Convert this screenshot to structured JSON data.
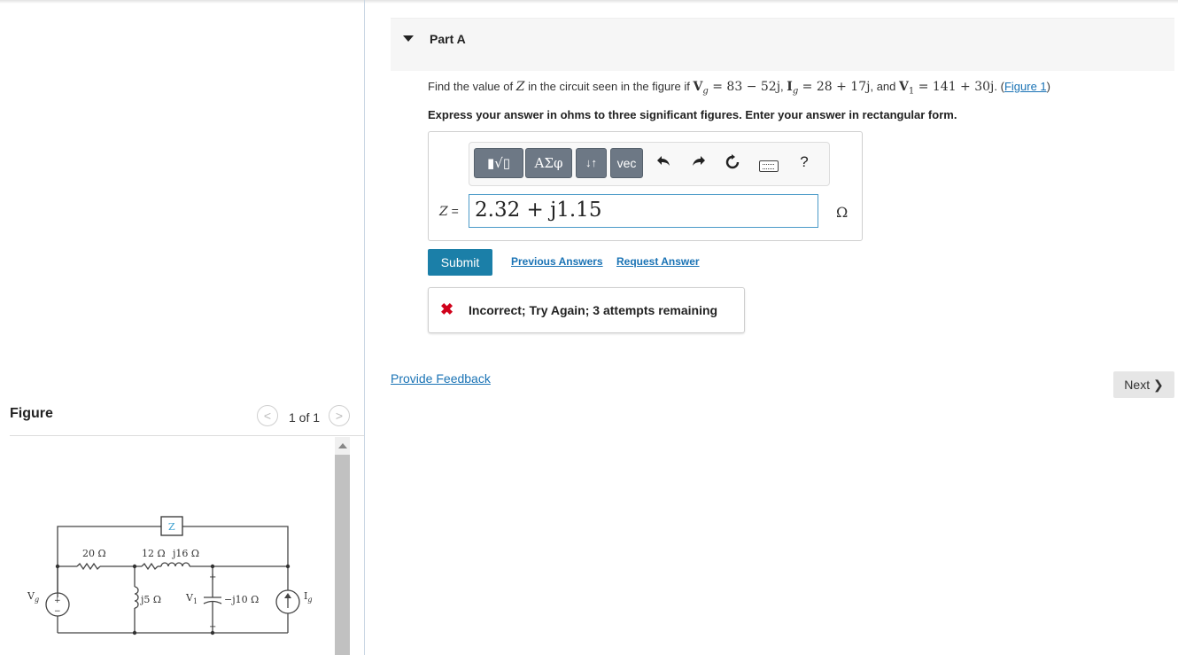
{
  "part": {
    "title": "Part A"
  },
  "question": {
    "find": "Find the value of ",
    "z": "Z",
    "mid": " in the circuit seen in the figure if ",
    "vg": "V",
    "vg_sub": "g",
    "vg_val": " = 83 − 52j",
    "comma1": ", ",
    "ig": "I",
    "ig_sub": "g",
    "ig_val": " = 28 + 17j",
    "and": ", and ",
    "v1": "V",
    "v1_sub": "1",
    "v1_val": " = 141 + 30j",
    "period": ". (",
    "figure_link": "Figure 1",
    "close": ")"
  },
  "instruction": "Express your answer in ohms to three significant figures. Enter your answer in rectangular form.",
  "toolbar": {
    "templates_label": "▮√▯",
    "greek_label": "ΑΣφ",
    "arrows_label": "↓↑",
    "vec_label": "vec",
    "undo_icon": "undo-icon",
    "redo_icon": "redo-icon",
    "reset_icon": "reset-icon",
    "keyboard_icon": "keyboard-icon",
    "help_label": "?"
  },
  "answer": {
    "label_var": "Z",
    "label_eq": " = ",
    "value": "2.32 + j1.15",
    "unit": "Ω"
  },
  "actions": {
    "submit": "Submit",
    "previous_answers": "Previous Answers",
    "request_answer": "Request Answer"
  },
  "feedback": {
    "icon": "✖",
    "text": "Incorrect; Try Again; 3 attempts remaining"
  },
  "provide_feedback": "Provide Feedback",
  "next": "Next ❯",
  "figure": {
    "title": "Figure",
    "prev": "<",
    "count": "1 of 1",
    "next": ">",
    "labels": {
      "z": "Z",
      "r20": "20 Ω",
      "r12": "12 Ω",
      "l16": "j16 Ω",
      "l5": "j5 Ω",
      "c10": "−j10 Ω",
      "v1": "V",
      "v1_sub": "1",
      "vg": "V",
      "vg_sub": "g",
      "ig": "I",
      "ig_sub": "g",
      "plus": "+",
      "minus": "−"
    }
  },
  "colors": {
    "accent": "#1b7fa8",
    "link": "#1a73b5",
    "error": "#d0021b",
    "toolbar_button": "#6d7885"
  }
}
